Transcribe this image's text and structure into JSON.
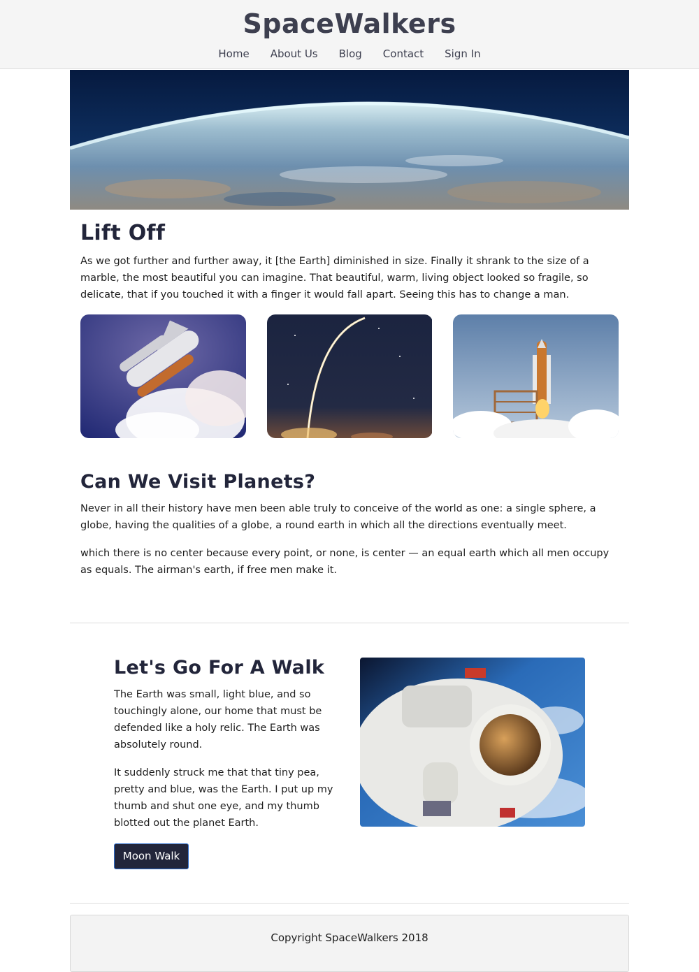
{
  "header": {
    "brand": "SpaceWalkers",
    "nav": [
      "Home",
      "About Us",
      "Blog",
      "Contact",
      "Sign In"
    ]
  },
  "hero": {
    "image": "earth-horizon"
  },
  "lift_off": {
    "title": "Lift Off",
    "paragraph": "As we got further and further away, it [the Earth] diminished in size. Finally it shrank to the size of a marble, the most beautiful you can imagine. That beautiful, warm, living object looked so fragile, so delicate, that if you touched it with a finger it would fall apart. Seeing this has to change a man.",
    "images": [
      "space-shuttle-launch",
      "rocket-trail-night",
      "shuttle-launch-pad"
    ]
  },
  "planets": {
    "title": "Can We Visit Planets?",
    "paragraphs": [
      "Never in all their history have men been able truly to conceive of the world as one: a single sphere, a globe, having the qualities of a globe, a round earth in which all the directions eventually meet.",
      "which there is no center because every point, or none, is center — an equal earth which all men occupy as equals. The airman's earth, if free men make it."
    ]
  },
  "walk": {
    "title": "Let's Go For A Walk",
    "paragraphs": [
      "The Earth was small, light blue, and so touchingly alone, our home that must be defended like a holy relic. The Earth was absolutely round.",
      "It suddenly struck me that that tiny pea, pretty and blue, was the Earth. I put up my thumb and shut one eye, and my thumb blotted out the planet Earth."
    ],
    "button_label": "Moon Walk",
    "image": "astronaut-spacewalk"
  },
  "footer": {
    "copyright": "Copyright SpaceWalkers 2018"
  },
  "colors": {
    "header_bg": "#f5f5f5",
    "heading": "#22253a",
    "button_bg": "#22253a",
    "button_border": "#2f6fd0"
  }
}
